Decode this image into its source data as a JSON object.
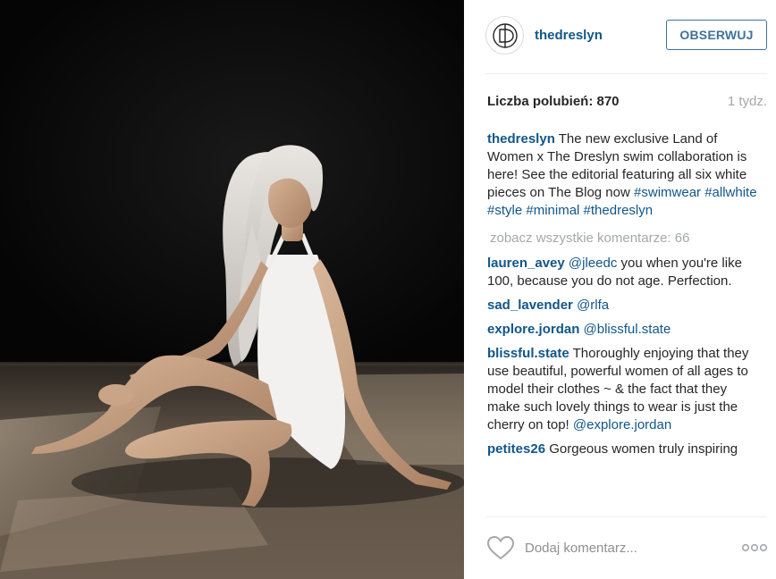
{
  "header": {
    "username": "thedreslyn",
    "follow_label": "OBSERWUJ"
  },
  "stats": {
    "likes": "Liczba polubień: 870",
    "time": "1 tydz."
  },
  "caption": {
    "username": "thedreslyn",
    "text": "The new exclusive Land of Women x The Dreslyn swim collaboration is here! See the editorial featuring all six white pieces on The Blog now",
    "hashtags": [
      "#swimwear",
      "#allwhite",
      "#style",
      "#minimal",
      "#thedreslyn"
    ]
  },
  "view_all": "zobacz wszystkie komentarze: 66",
  "comments": [
    {
      "username": "lauren_avey",
      "mention": "@jleedc",
      "text": "you when you're like 100, because you do not age. Perfection."
    },
    {
      "username": "sad_lavender",
      "mention": "@rlfa",
      "text": ""
    },
    {
      "username": "explore.jordan",
      "mention": "@blissful.state",
      "text": ""
    },
    {
      "username": "blissful.state",
      "text": "Thoroughly enjoying that they use beautiful, powerful women of all ages to model their clothes ~ & the fact that they make such lovely things to wear is just the cherry on top!",
      "mention_after": "@explore.jordan"
    },
    {
      "username": "petites26",
      "text": "Gorgeous women truly inspiring"
    }
  ],
  "footer": {
    "placeholder": "Dodaj komentarz..."
  },
  "icons": {
    "like": "heart-outline-icon",
    "more": "more-options-icon",
    "avatar": "dreslyn-logo"
  },
  "colors": {
    "link": "#125688",
    "follow": "#3f729b",
    "muted": "#a5a7aa"
  }
}
